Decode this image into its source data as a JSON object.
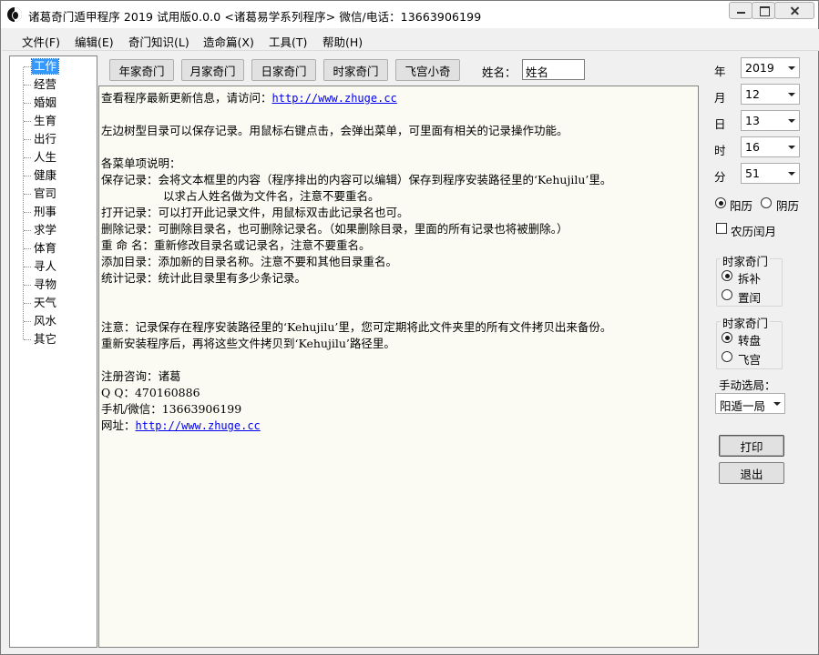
{
  "window": {
    "title": "诸葛奇门遁甲程序  2019  试用版0.0.0  <诸葛易学系列程序>    微信/电话：13663906199"
  },
  "menu": [
    "文件(F)",
    "编辑(E)",
    "奇门知识(L)",
    "造命篇(X)",
    "工具(T)",
    "帮助(H)"
  ],
  "tree": {
    "items": [
      "工作",
      "经营",
      "婚姻",
      "生育",
      "出行",
      "人生",
      "健康",
      "官司",
      "刑事",
      "求学",
      "体育",
      "寻人",
      "寻物",
      "天气",
      "风水",
      "其它"
    ],
    "selected": "工作"
  },
  "toolbar": {
    "buttons": [
      "年家奇门",
      "月家奇门",
      "日家奇门",
      "时家奇门",
      "飞宫小奇"
    ],
    "name_label": "姓名：",
    "name_value": "姓名"
  },
  "content": {
    "line1_prefix": "查看程序最新更新信息，请访问：",
    "url": "http://www.zhuge.cc",
    "line2": "左边树型目录可以保存记录。用鼠标右键点击，会弹出菜单，可里面有相关的记录操作功能。",
    "line3": "各菜单项说明：",
    "line4": "保存记录：会将文本框里的内容（程序排出的内容可以编辑）保存到程序安装路径里的‘Kehujilu’里。",
    "line5": "          以求占人姓名做为文件名，注意不要重名。",
    "line6": "打开记录：可以打开此记录文件，用鼠标双击此记录名也可。",
    "line7": "删除记录：可删除目录名，也可删除记录名。（如果删除目录，里面的所有记录也将被删除。）",
    "line8": "重 命 名：重新修改目录名或记录名，注意不要重名。",
    "line9": "添加目录：添加新的目录名称。注意不要和其他目录重名。",
    "line10": "统计记录：统计此目录里有多少条记录。",
    "line11": "注意：记录保存在程序安装路径里的‘Kehujilu’里，您可定期将此文件夹里的所有文件拷贝出来备份。",
    "line12": "重新安装程序后，再将这些文件拷贝到‘Kehujilu’路径里。",
    "line13": "注册咨询：诸葛",
    "line14": "Q  Q：470160886",
    "line15": "手机/微信：13663906199",
    "line16_prefix": "网址："
  },
  "date": {
    "year_label": "年",
    "year": "2019",
    "month_label": "月",
    "month": "12",
    "day_label": "日",
    "day": "13",
    "hour_label": "时",
    "hour": "16",
    "minute_label": "分",
    "minute": "51"
  },
  "calendar": {
    "solar": "阳历",
    "lunar": "阴历",
    "selected": "阳历",
    "leap_month": "农历闰月",
    "leap_checked": false
  },
  "group1": {
    "title": "时家奇门",
    "options": [
      "拆补",
      "置闰"
    ],
    "selected": "拆补"
  },
  "group2": {
    "title": "时家奇门",
    "options": [
      "转盘",
      "飞宫"
    ],
    "selected": "转盘"
  },
  "manual": {
    "label": "手动选局：",
    "value": "阳遁一局"
  },
  "actions": {
    "print": "打印",
    "exit": "退出"
  }
}
